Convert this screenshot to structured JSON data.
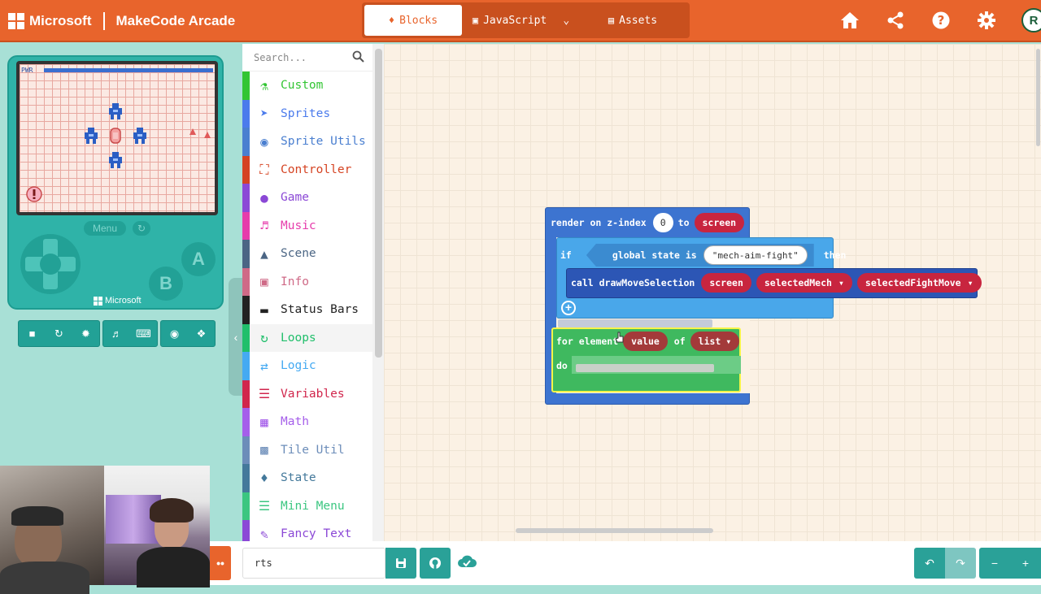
{
  "app": {
    "brand": "Microsoft",
    "title": "MakeCode Arcade"
  },
  "header": {
    "tabs": [
      {
        "label": "Blocks",
        "icon": "puzzle-icon",
        "active": true
      },
      {
        "label": "JavaScript",
        "icon": "js-icon",
        "active": false
      },
      {
        "label": "Assets",
        "icon": "image-icon",
        "active": false
      }
    ],
    "avatar_initial": "R"
  },
  "simulator": {
    "hud_label": "PWR",
    "menu_label": "Menu",
    "a_label": "A",
    "b_label": "B",
    "brand_label": "Microsoft"
  },
  "toolbox": {
    "search_placeholder": "Search...",
    "categories": [
      {
        "label": "Custom",
        "color": "#32c533",
        "icon": "flask-icon"
      },
      {
        "label": "Sprites",
        "color": "#4b7bec",
        "icon": "paper-plane-icon"
      },
      {
        "label": "Sprite Utils",
        "color": "#4a7fd0",
        "icon": "user-circle-icon"
      },
      {
        "label": "Controller",
        "color": "#d54322",
        "icon": "gamepad-icon"
      },
      {
        "label": "Game",
        "color": "#8b48d6",
        "icon": "circle-icon"
      },
      {
        "label": "Music",
        "color": "#e63cab",
        "icon": "headphones-icon"
      },
      {
        "label": "Scene",
        "color": "#4b6584",
        "icon": "tree-icon"
      },
      {
        "label": "Info",
        "color": "#cf6a87",
        "icon": "id-card-icon"
      },
      {
        "label": "Status Bars",
        "color": "#222222",
        "icon": "status-bar-icon"
      },
      {
        "label": "Loops",
        "color": "#20bf6b",
        "icon": "loop-icon"
      },
      {
        "label": "Logic",
        "color": "#45aaf2",
        "icon": "shuffle-icon"
      },
      {
        "label": "Variables",
        "color": "#d1264c",
        "icon": "list-icon"
      },
      {
        "label": "Math",
        "color": "#a55eea",
        "icon": "calculator-icon"
      },
      {
        "label": "Tile Util",
        "color": "#6c8db9",
        "icon": "map-icon"
      },
      {
        "label": "State",
        "color": "#44799b",
        "icon": "puzzle-piece-icon"
      },
      {
        "label": "Mini Menu",
        "color": "#3bc680",
        "icon": "menu-lines-icon"
      },
      {
        "label": "Fancy Text",
        "color": "#8b48d6",
        "icon": "pen-icon"
      }
    ]
  },
  "workspace": {
    "render_block": {
      "prefix": "render on z-index",
      "z_index": "0",
      "to_label": "to",
      "target": "screen"
    },
    "if_block": {
      "if_label": "if",
      "condition": "global state is",
      "state_value": "mech-aim-fight",
      "then_label": "then"
    },
    "call_block": {
      "label": "call drawMoveSelection",
      "arg1": "screen",
      "arg2": "selectedMech",
      "arg3": "selectedFightMove"
    },
    "for_block": {
      "label": "for element",
      "var": "value",
      "of_label": "of",
      "list": "list",
      "do_label": "do"
    }
  },
  "bottombar": {
    "project_name": "rts"
  }
}
